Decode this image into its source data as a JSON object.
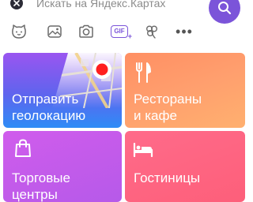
{
  "search": {
    "placeholder": "Искать на Яндекс.Картах",
    "value": ""
  },
  "icon_row": {
    "icons": [
      "cat-face-icon",
      "image-icon",
      "camera-icon",
      "gif-icon",
      "clover-icon",
      "more-icon"
    ],
    "gif_label": "GIF",
    "gif_plus": "+",
    "more_label": "•••"
  },
  "tiles": {
    "geo": {
      "line1": "Отправить",
      "line2": "геолокацию",
      "icon": "map-pin-icon"
    },
    "food": {
      "line1": "Рестораны",
      "line2": "и кафе",
      "icon": "fork-knife-icon"
    },
    "shop": {
      "line1": "Торговые",
      "line2": "центры",
      "icon": "shopping-bag-icon"
    },
    "hotel": {
      "line1": "Гостиницы",
      "icon": "bed-icon"
    }
  },
  "colors": {
    "accent": "#7b54d9",
    "geo_tile": "#5f64ee",
    "food_tile": "#ff9f6e",
    "shop_tile": "#c95beb",
    "hotel_tile": "#fd5f7a"
  }
}
